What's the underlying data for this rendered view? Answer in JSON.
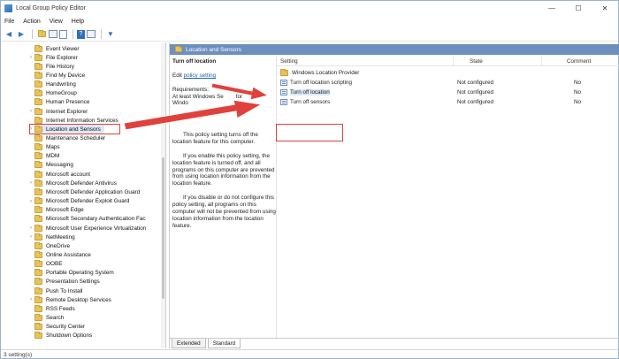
{
  "window": {
    "title": "Local Group Policy Editor",
    "minimize": "—",
    "maximize": "☐",
    "close": "✕"
  },
  "menu": [
    "File",
    "Action",
    "View",
    "Help"
  ],
  "toolbar": {
    "back_icon": "arrow-left-icon",
    "forward_icon": "arrow-right-icon",
    "up_icon": "folder-up-icon",
    "filter_icon": "filter-icon"
  },
  "tree": {
    "items": [
      {
        "label": "Event Viewer"
      },
      {
        "label": "File Explorer",
        "exp": "›"
      },
      {
        "label": "File History"
      },
      {
        "label": "Find My Device"
      },
      {
        "label": "Handwriting"
      },
      {
        "label": "HomeGroup"
      },
      {
        "label": "Human Presence"
      },
      {
        "label": "Internet Explorer",
        "exp": "›"
      },
      {
        "label": "Internet Information Services"
      },
      {
        "label": "Location and Sensors",
        "exp": "›",
        "selected": true
      },
      {
        "label": "Maintenance Scheduler"
      },
      {
        "label": "Maps"
      },
      {
        "label": "MDM"
      },
      {
        "label": "Messaging"
      },
      {
        "label": "Microsoft account"
      },
      {
        "label": "Microsoft Defender Antivirus",
        "exp": "›"
      },
      {
        "label": "Microsoft Defender Application Guard"
      },
      {
        "label": "Microsoft Defender Exploit Guard",
        "exp": "›"
      },
      {
        "label": "Microsoft Edge"
      },
      {
        "label": "Microsoft Secondary Authentication Fac"
      },
      {
        "label": "Microsoft User Experience Virtualization",
        "exp": "›"
      },
      {
        "label": "NetMeeting",
        "exp": "›"
      },
      {
        "label": "OneDrive"
      },
      {
        "label": "Online Assistance"
      },
      {
        "label": "OOBE"
      },
      {
        "label": "Portable Operating System"
      },
      {
        "label": "Presentation Settings"
      },
      {
        "label": "Push To Install"
      },
      {
        "label": "Remote Desktop Services",
        "exp": "›"
      },
      {
        "label": "RSS Feeds"
      },
      {
        "label": "Search"
      },
      {
        "label": "Security Center"
      },
      {
        "label": "Shutdown Options"
      }
    ]
  },
  "details": {
    "header": "Location and Sensors",
    "policy_title": "Turn off location",
    "edit_prefix": "Edit ",
    "edit_link": "policy setting",
    "requirements_label": "Requirements:",
    "requirements_text_a": "At least Windows Se",
    "requirements_text_b": "for",
    "requirements_text_c": "Windo",
    "description_label": "Description:",
    "p1": "This policy setting turns off the location feature for this computer.",
    "p2": "If you enable this policy setting, the location feature is turned off, and all programs on this computer are prevented from using location information from the location feature.",
    "p3": "If you disable or do not configure this policy setting, all programs on this computer will not be prevented from using location information from the location feature."
  },
  "grid": {
    "columns": [
      "Setting",
      "State",
      "Comment"
    ],
    "rows": [
      {
        "setting": "Windows Location Provider",
        "state": "",
        "comment": "",
        "kind": "folder"
      },
      {
        "setting": "Turn off location scripting",
        "state": "Not configured",
        "comment": "No",
        "kind": "policy"
      },
      {
        "setting": "Turn off location",
        "state": "Not configured",
        "comment": "No",
        "kind": "policy",
        "selected": true
      },
      {
        "setting": "Turn off sensors",
        "state": "Not configured",
        "comment": "No",
        "kind": "policy"
      }
    ]
  },
  "tabs": [
    "Extended",
    "Standard"
  ],
  "status": "3 setting(s)",
  "colors": {
    "annotation": "#e0413b",
    "header": "#6d8fbe"
  }
}
